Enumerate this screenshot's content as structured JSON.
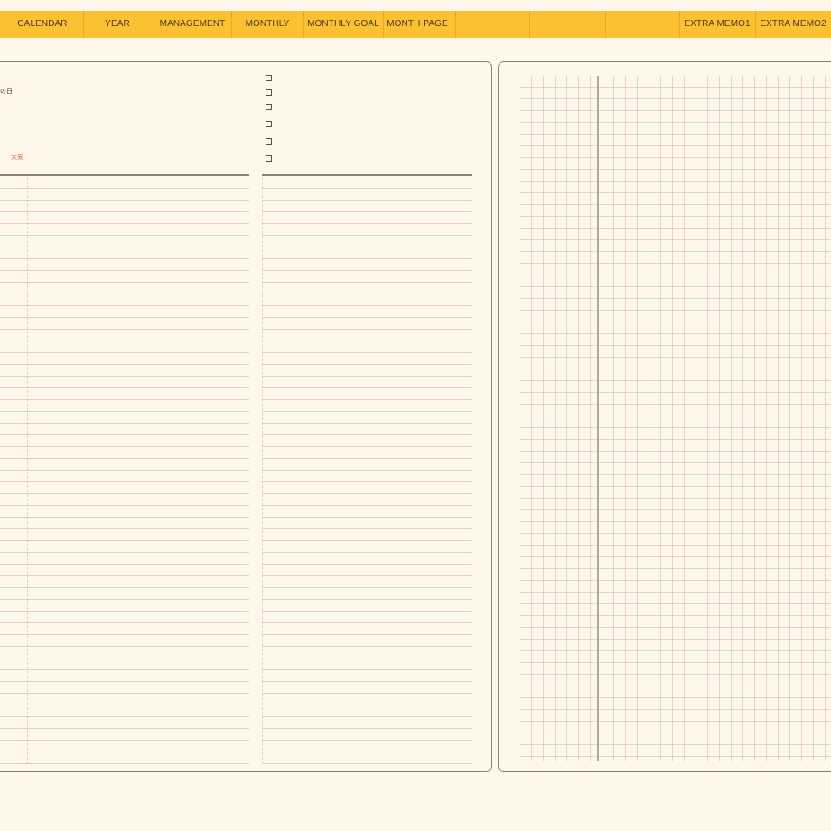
{
  "nav": {
    "tabs": [
      {
        "label": "CALENDAR"
      },
      {
        "label": "YEAR"
      },
      {
        "label": "MANAGEMENT"
      },
      {
        "label": "MONTHLY"
      },
      {
        "label": "MONTHLY GOAL"
      },
      {
        "label": "MONTH PAGE"
      },
      {
        "label": "EXTRA MEMO1"
      },
      {
        "label": "EXTRA MEMO2"
      }
    ]
  },
  "left_page": {
    "header_label": "の日",
    "red_label": "大安",
    "checkbox_count": 6
  },
  "colors": {
    "background": "#fff7ea",
    "nav_bar": "#fcc132",
    "panel_border": "#8c8273",
    "accent_red": "#e05a4a"
  }
}
